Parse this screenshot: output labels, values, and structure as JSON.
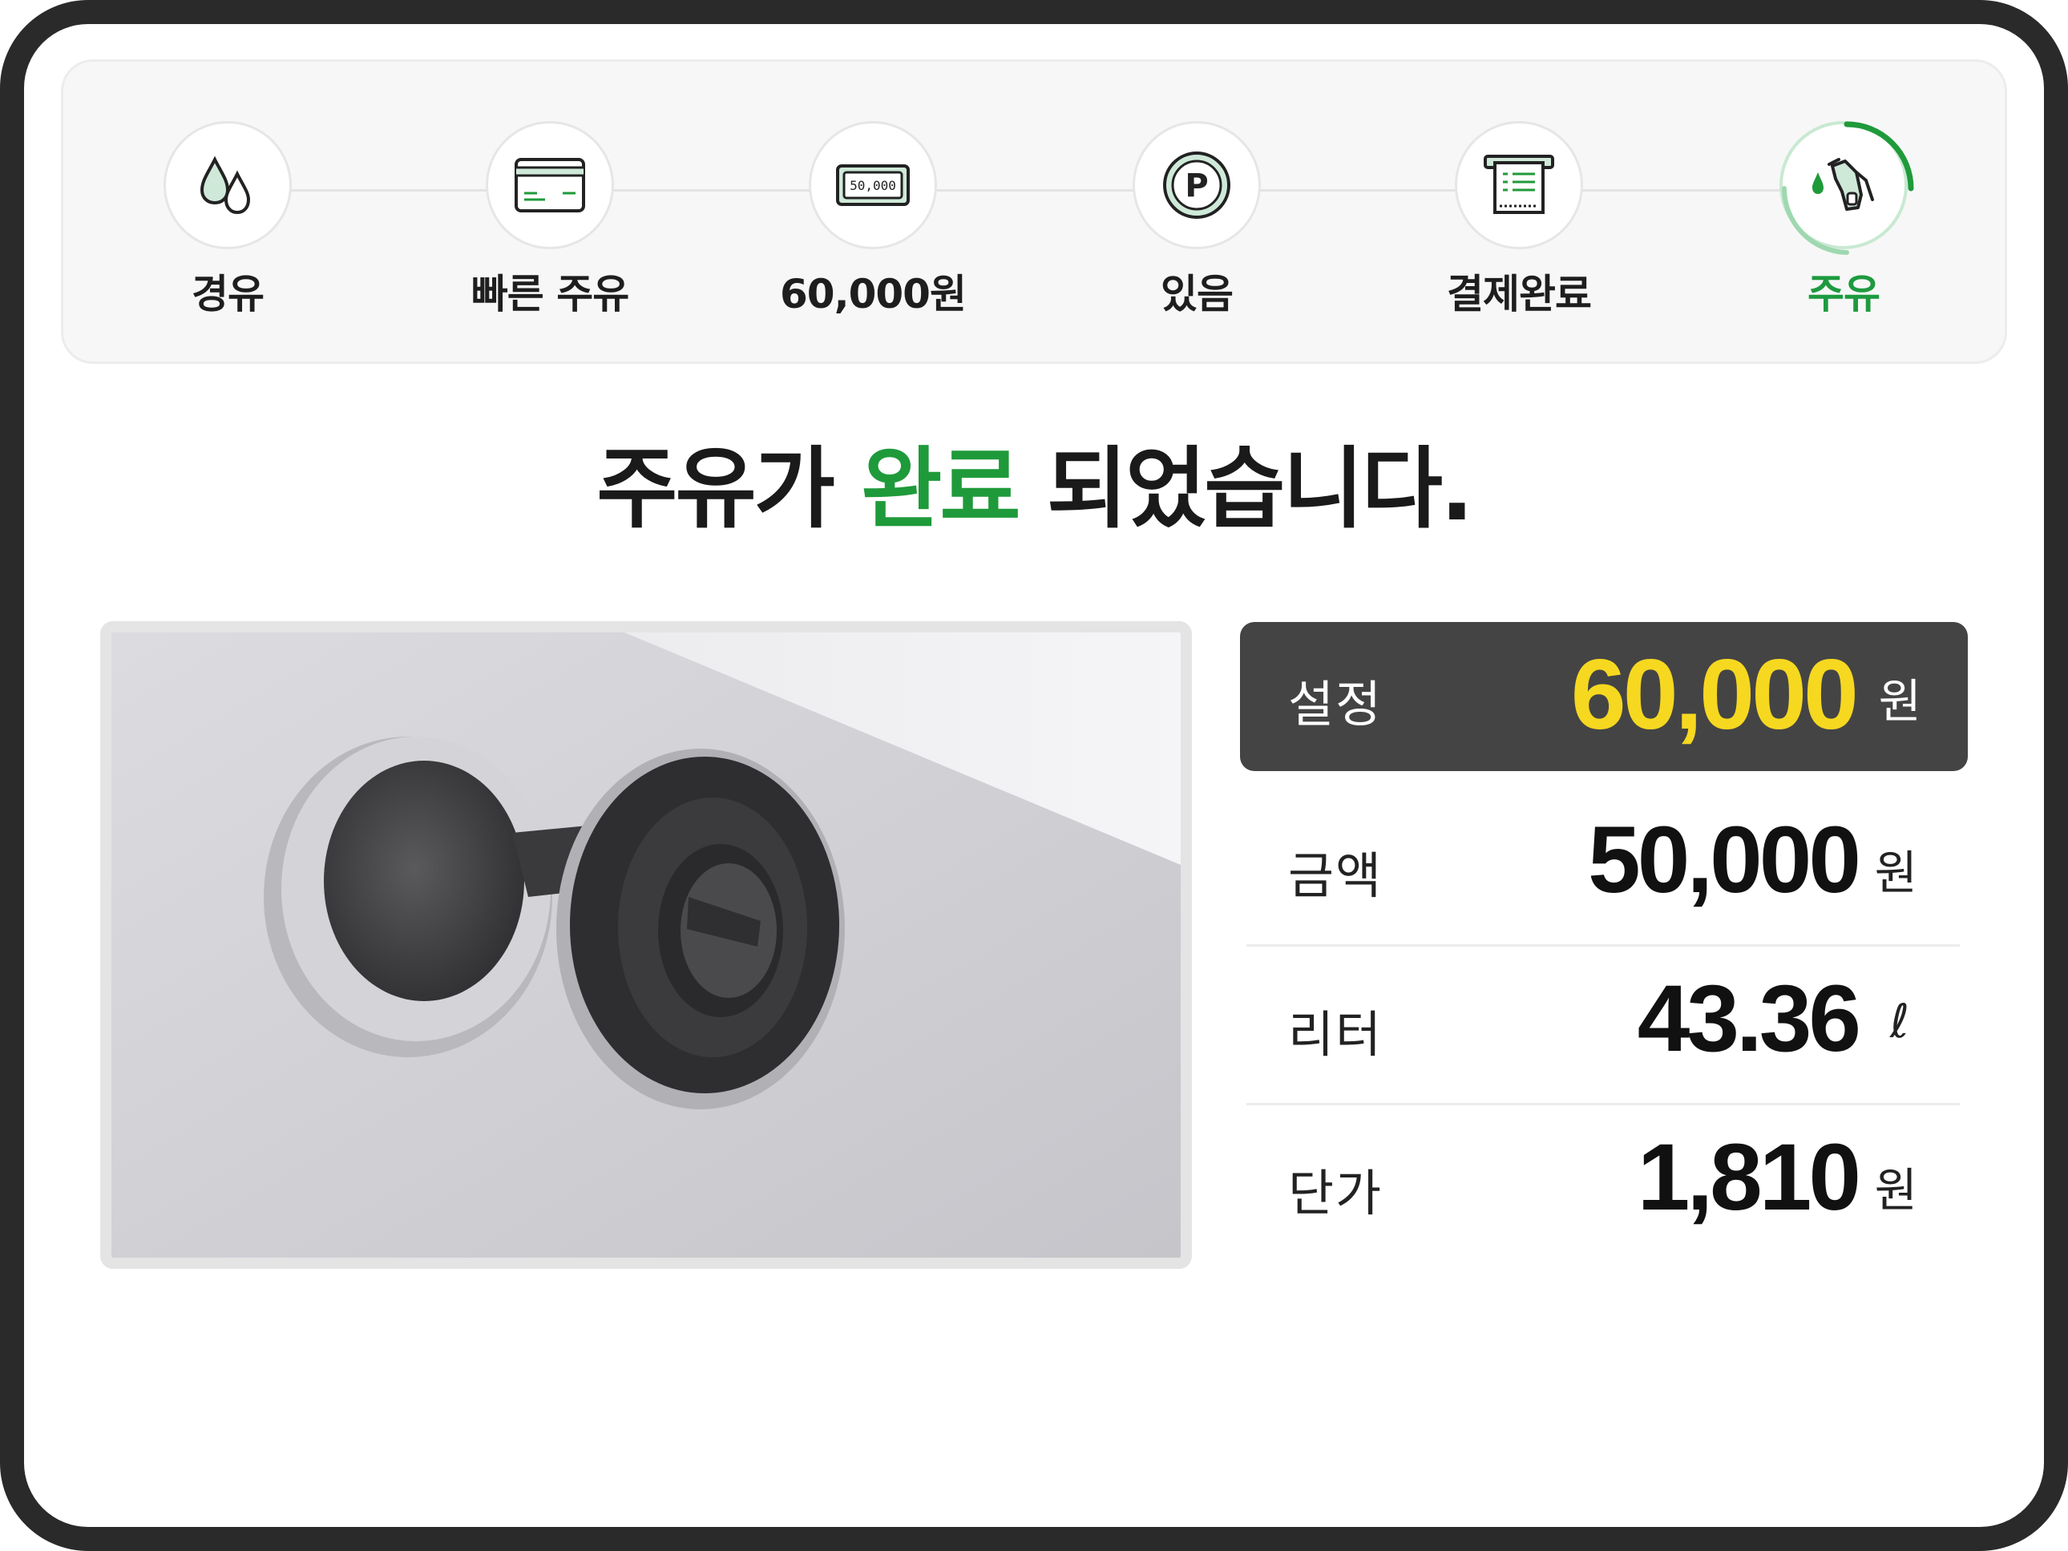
{
  "steps": [
    {
      "label": "경유",
      "icon": "fuel-drops-icon"
    },
    {
      "label": "빠른 주유",
      "icon": "card-icon"
    },
    {
      "label": "60,000원",
      "icon": "banknote-icon",
      "note_text": "50,000"
    },
    {
      "label": "있음",
      "icon": "parking-point-icon",
      "badge_text": "P"
    },
    {
      "label": "결제완료",
      "icon": "receipt-icon"
    },
    {
      "label": "주유",
      "icon": "fuel-nozzle-icon",
      "active": true
    }
  ],
  "headline": {
    "before": "주유가",
    "accent": "완료",
    "after": "되었습니다."
  },
  "summary": {
    "preset": {
      "label": "설정",
      "value": "60,000",
      "unit": "원"
    },
    "rows": [
      {
        "label": "금액",
        "value": "50,000",
        "unit": "원"
      },
      {
        "label": "리터",
        "value": "43.36",
        "unit": "ℓ"
      },
      {
        "label": "단가",
        "value": "1,810",
        "unit": "원"
      }
    ]
  },
  "colors": {
    "accent_green": "#1f9a3a",
    "preset_value_yellow": "#f6d820",
    "preset_bg": "#444444"
  }
}
